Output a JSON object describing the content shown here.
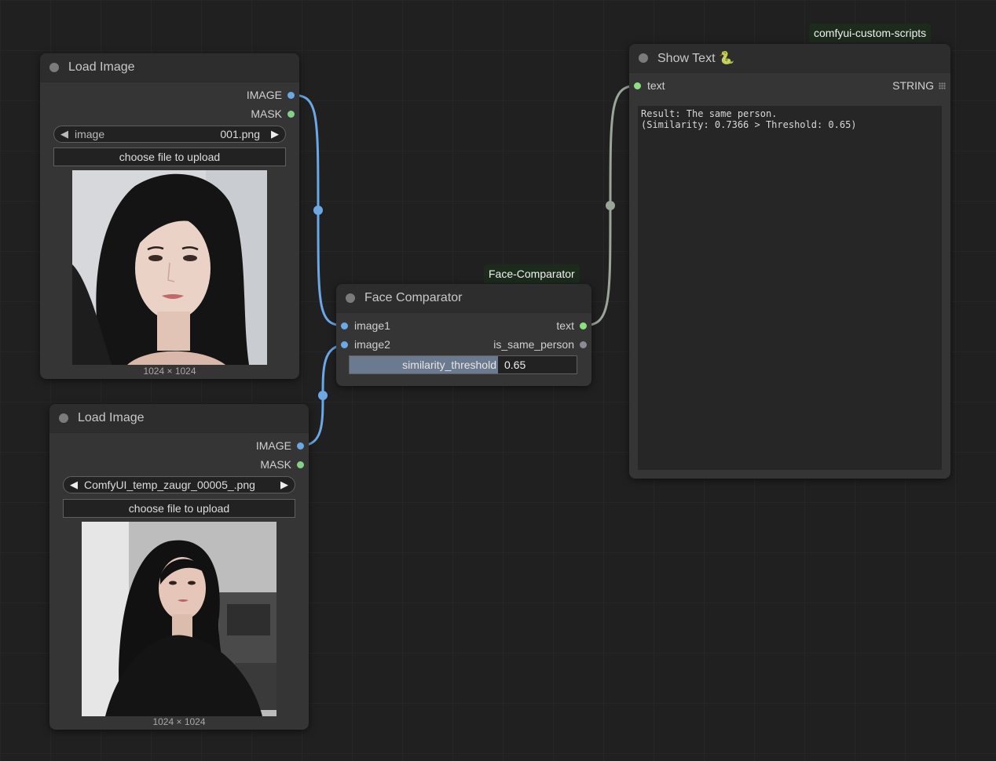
{
  "colors": {
    "canvas": "#202020",
    "node_body": "#353535",
    "image_link": "#6ca7e6",
    "string_link": "#9aa69a"
  },
  "icons": {
    "show_text_emoji": "snake-emoji"
  },
  "nodes": {
    "load_image_1": {
      "title": "Load Image",
      "outputs": [
        "IMAGE",
        "MASK"
      ],
      "widget_name": "image",
      "widget_value": "001.png",
      "upload_label": "choose file to upload",
      "dims": "1024 × 1024"
    },
    "load_image_2": {
      "title": "Load Image",
      "outputs": [
        "IMAGE",
        "MASK"
      ],
      "widget_value": "ComfyUI_temp_zaugr_00005_.png",
      "upload_label": "choose file to upload",
      "dims": "1024 × 1024"
    },
    "face_comparator": {
      "badge": "Face-Comparator",
      "title": "Face Comparator",
      "inputs": [
        "image1",
        "image2"
      ],
      "outputs": [
        "text",
        "is_same_person"
      ],
      "threshold_label": "similarity_threshold",
      "threshold_value": "0.65"
    },
    "show_text": {
      "badge": "comfyui-custom-scripts",
      "title": "Show Text 🐍",
      "input": "text",
      "output": "STRING",
      "result_line1": "Result: The same person.",
      "result_line2": "(Similarity: 0.7366 > Threshold: 0.65)"
    }
  }
}
